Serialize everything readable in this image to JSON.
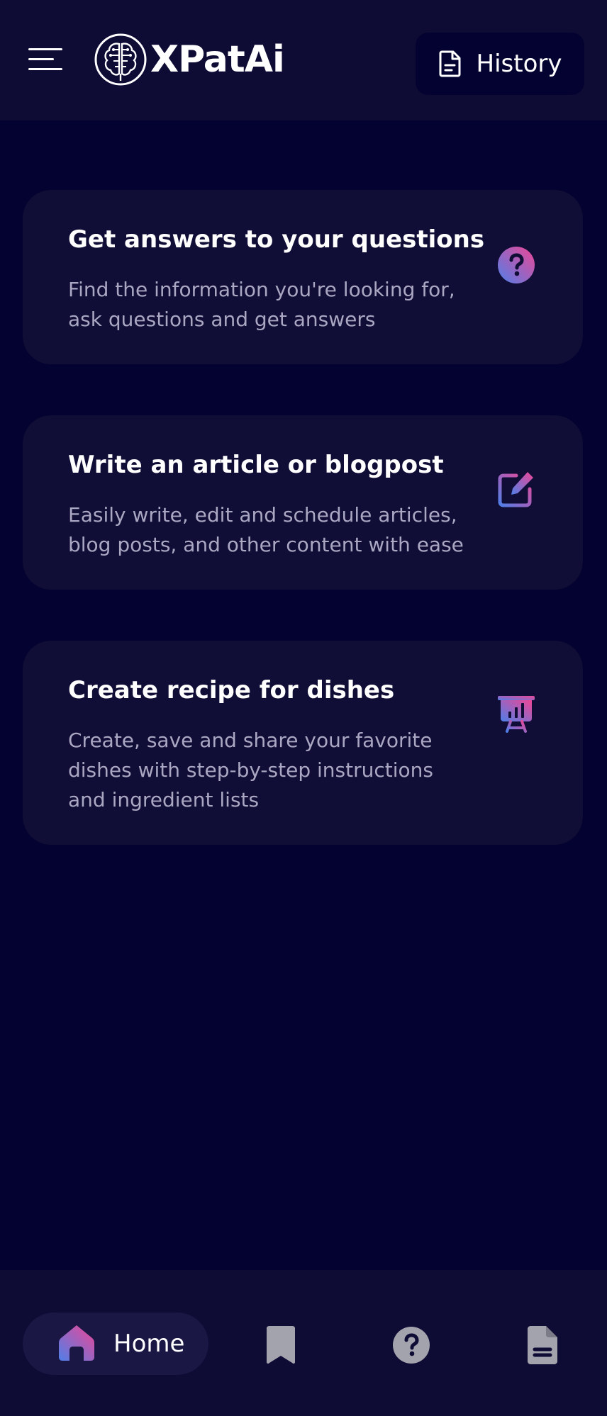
{
  "header": {
    "menu_icon": "hamburger-menu-icon",
    "logo_text": "XPatAi",
    "history_label": "History",
    "history_icon": "document-icon"
  },
  "cards": [
    {
      "title": "Get answers to your questions",
      "description": "Find the information you're looking for, ask questions and get answers",
      "icon": "question-circle-icon"
    },
    {
      "title": "Write an article or blogpost",
      "description": "Easily write, edit and schedule articles, blog posts, and other content with ease",
      "icon": "edit-icon"
    },
    {
      "title": "Create recipe for dishes",
      "description": "Create, save and share your favorite dishes with step-by-step instructions and ingredient lists",
      "icon": "presentation-chart-icon"
    }
  ],
  "bottom_nav": {
    "items": [
      {
        "label": "Home",
        "icon": "home-icon",
        "active": true
      },
      {
        "label": "",
        "icon": "bookmark-icon",
        "active": false
      },
      {
        "label": "",
        "icon": "question-circle-icon",
        "active": false
      },
      {
        "label": "",
        "icon": "document-icon",
        "active": false
      }
    ]
  },
  "colors": {
    "background": "#040230",
    "surface": "#100d36",
    "header": "#0e0b35",
    "gradient_start": "#5a78e6",
    "gradient_end": "#e64a9c",
    "muted_text": "#a9a7c2",
    "inactive_icon": "#a3a3ad"
  }
}
